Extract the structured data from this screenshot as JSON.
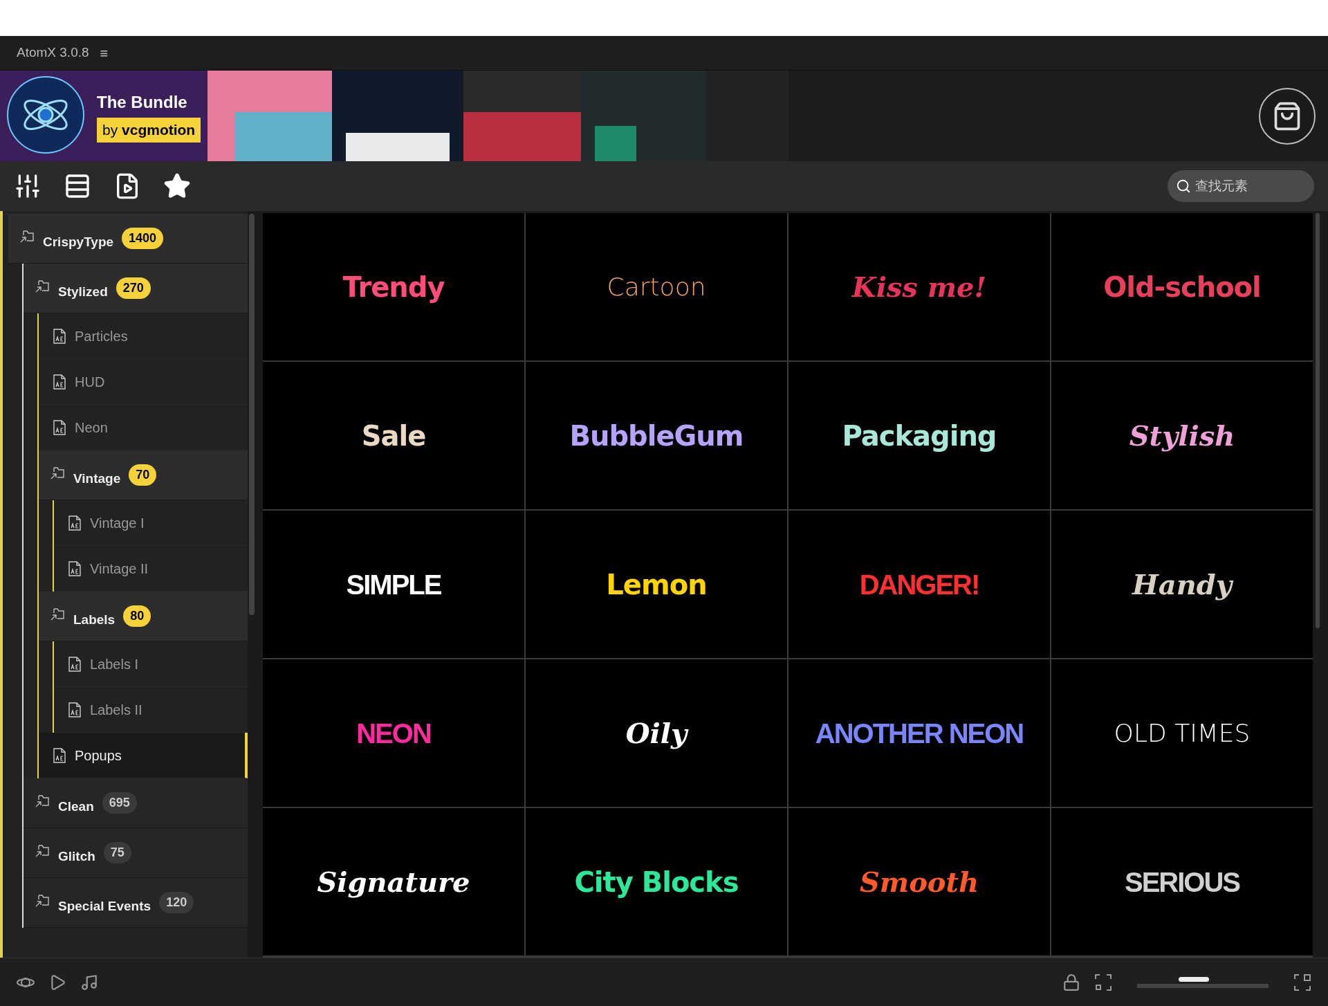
{
  "window": {
    "title": "AtomX 3.0.8",
    "menu_glyph": "≡"
  },
  "banner": {
    "title": "The Bundle",
    "byline_prefix": "by",
    "byline_name": "vcgmotion"
  },
  "search": {
    "placeholder": "查找元素"
  },
  "tree": [
    {
      "label": "CrispyType",
      "kind": "folder",
      "count": "1400",
      "expanded": true,
      "selected": false,
      "children": [
        {
          "label": "Stylized",
          "kind": "folder",
          "count": "270",
          "expanded": true,
          "selected": false,
          "children": [
            {
              "label": "Particles",
              "kind": "file",
              "selected": false
            },
            {
              "label": "HUD",
              "kind": "file",
              "selected": false
            },
            {
              "label": "Neon",
              "kind": "file",
              "selected": false
            },
            {
              "label": "Vintage",
              "kind": "folder",
              "count": "70",
              "expanded": true,
              "selected": false,
              "children": [
                {
                  "label": "Vintage I",
                  "kind": "file",
                  "selected": false
                },
                {
                  "label": "Vintage II",
                  "kind": "file",
                  "selected": false
                }
              ]
            },
            {
              "label": "Labels",
              "kind": "folder",
              "count": "80",
              "expanded": true,
              "selected": false,
              "children": [
                {
                  "label": "Labels I",
                  "kind": "file",
                  "selected": false
                },
                {
                  "label": "Labels II",
                  "kind": "file",
                  "selected": false
                }
              ]
            },
            {
              "label": "Popups",
              "kind": "file",
              "selected": true
            }
          ]
        },
        {
          "label": "Clean",
          "kind": "folder",
          "count": "695",
          "expanded": false,
          "selected": false
        },
        {
          "label": "Glitch",
          "kind": "folder",
          "count": "75",
          "expanded": false,
          "selected": false
        },
        {
          "label": "Special Events",
          "kind": "folder",
          "count": "120",
          "expanded": false,
          "selected": false
        }
      ]
    }
  ],
  "tiles": [
    {
      "text": "Trendy",
      "kind": "bold",
      "color": "#ff4d7a"
    },
    {
      "text": "Cartoon",
      "kind": "light",
      "color": "#f5a35c"
    },
    {
      "text": "Kiss me!",
      "kind": "script",
      "color": "#e8335a"
    },
    {
      "text": "Old-school",
      "kind": "bold",
      "color": "#e8405a"
    },
    {
      "text": "Sale",
      "kind": "bold",
      "color": "#ecd9c4"
    },
    {
      "text": "BubbleGum",
      "kind": "bold",
      "color": "#b7a3ff"
    },
    {
      "text": "Packaging",
      "kind": "bold",
      "color": "#a8e8d8"
    },
    {
      "text": "Stylish",
      "kind": "script",
      "color": "#f0a0d8"
    },
    {
      "text": "SIMPLE",
      "kind": "condensed",
      "color": "#ffffff"
    },
    {
      "text": "Lemon",
      "kind": "bold",
      "color": "#ffd400"
    },
    {
      "text": "DANGER!",
      "kind": "condensed",
      "color": "#ff3030"
    },
    {
      "text": "Handy",
      "kind": "script",
      "color": "#d8d0c0"
    },
    {
      "text": "NEON",
      "kind": "condensed",
      "color": "#ff2aa0"
    },
    {
      "text": "Oily",
      "kind": "script",
      "color": "#ffffff"
    },
    {
      "text": "ANOTHER NEON",
      "kind": "condensed",
      "color": "#7a86ff"
    },
    {
      "text": "OLD TIMES",
      "kind": "light",
      "color": "#ffffff"
    },
    {
      "text": "Signature",
      "kind": "script",
      "color": "#ffffff"
    },
    {
      "text": "City Blocks",
      "kind": "bold",
      "color": "#2ee89a"
    },
    {
      "text": "Smooth",
      "kind": "script",
      "color": "#ff5a2a"
    },
    {
      "text": "SERIOUS",
      "kind": "condensed",
      "color": "#d0d0d0"
    }
  ],
  "thumb_size": {
    "level": 0.43
  }
}
